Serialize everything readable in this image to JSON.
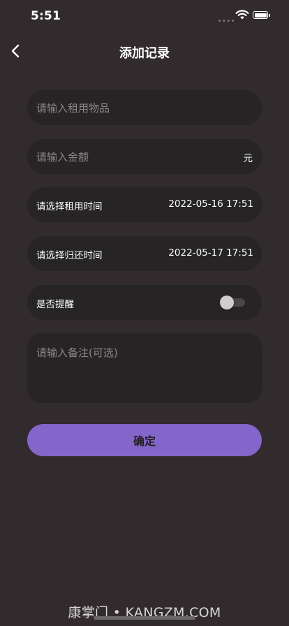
{
  "status": {
    "time": "5:51",
    "signal_dots": "••••",
    "icons": [
      "wifi-icon",
      "battery-icon"
    ]
  },
  "nav": {
    "title": "添加记录",
    "back_icon": "chevron-left-icon"
  },
  "form": {
    "item_placeholder": "请输入租用物品",
    "amount_placeholder": "请输入金额",
    "amount_unit": "元",
    "rent_time_label": "请选择租用时间",
    "rent_time_value": "2022-05-16 17:51",
    "return_time_label": "请选择归还时间",
    "return_time_value": "2022-05-17 17:51",
    "remind_label": "是否提醒",
    "remind_on": false,
    "notes_placeholder": "请输入备注(可选)",
    "confirm_label": "确定"
  },
  "watermark": "康掌门 • KANGZM.COM",
  "colors": {
    "background": "#312b2e",
    "field": "#262425",
    "accent": "#8465c9"
  }
}
